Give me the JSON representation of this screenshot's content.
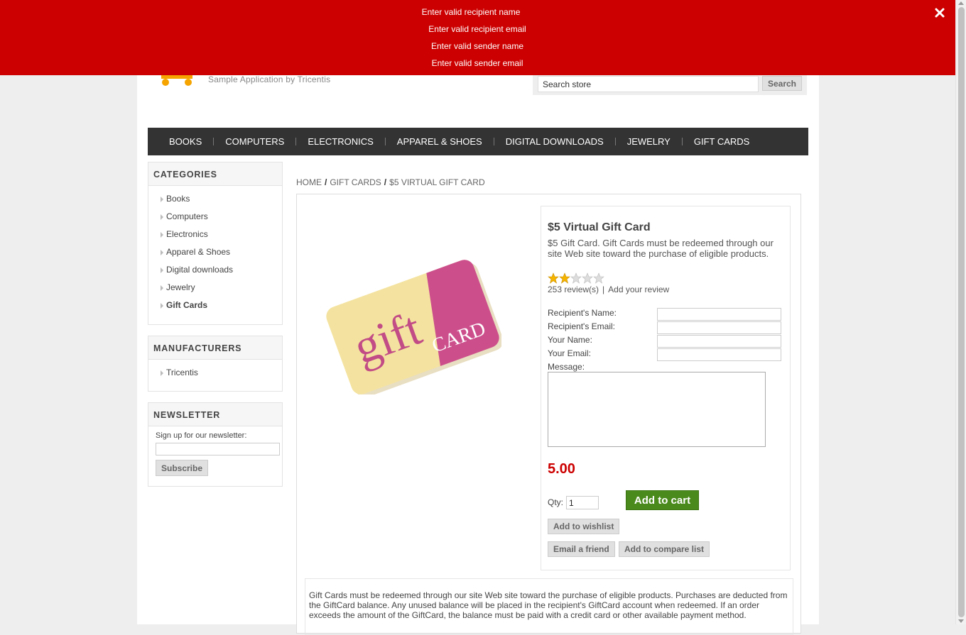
{
  "notification": {
    "messages": [
      "Enter valid recipient name",
      "Enter valid recipient email",
      "Enter valid sender name",
      "Enter valid sender email"
    ],
    "close_icon": "close-icon",
    "bg_color": "#cc0000"
  },
  "header": {
    "logo_subtitle": "Sample Application by Tricentis",
    "search_placeholder": "Search store",
    "search_button": "Search"
  },
  "menu": {
    "items": [
      "BOOKS",
      "COMPUTERS",
      "ELECTRONICS",
      "APPAREL & SHOES",
      "DIGITAL DOWNLOADS",
      "JEWELRY",
      "GIFT CARDS"
    ]
  },
  "categories": {
    "title": "CATEGORIES",
    "items": [
      "Books",
      "Computers",
      "Electronics",
      "Apparel & Shoes",
      "Digital downloads",
      "Jewelry",
      "Gift Cards"
    ],
    "active": "Gift Cards"
  },
  "manufacturers": {
    "title": "MANUFACTURERS",
    "items": [
      "Tricentis"
    ]
  },
  "newsletter": {
    "title": "NEWSLETTER",
    "label": "Sign up for our newsletter:",
    "button": "Subscribe"
  },
  "breadcrumb": {
    "home": "HOME",
    "category": "GIFT CARDS",
    "current": "$5 VIRTUAL GIFT CARD",
    "separator": "/"
  },
  "product": {
    "name": "$5 Virtual Gift Card",
    "short_description": "$5 Gift Card. Gift Cards must be redeemed through our site Web site toward the purchase of eligible products.",
    "rating": 2,
    "rating_max": 5,
    "reviews_link": "253 review(s)",
    "review_separator": "|",
    "add_review": "Add your review",
    "fields": {
      "recipient_name": "Recipient's Name:",
      "recipient_email": "Recipient's Email:",
      "your_name": "Your Name:",
      "your_email": "Your Email:",
      "message": "Message:"
    },
    "price": "5.00",
    "qty_label": "Qty:",
    "qty_value": "1",
    "add_to_cart": "Add to cart",
    "add_to_wishlist": "Add to wishlist",
    "email_friend": "Email a friend",
    "add_to_compare": "Add to compare list",
    "picture_text_1": "gift",
    "picture_text_2": "CARD",
    "full_description": "Gift Cards must be redeemed through our site Web site toward the purchase of eligible products. Purchases are deducted from the GiftCard balance. Any unused balance will be placed in the recipient's GiftCard account when redeemed. If an order exceeds the amount of the GiftCard, the balance must be paid with a credit card or other available payment method."
  },
  "colors": {
    "accent_red": "#cc0000",
    "cart_green": "#4a8a1c",
    "menu_bg": "#333333"
  }
}
